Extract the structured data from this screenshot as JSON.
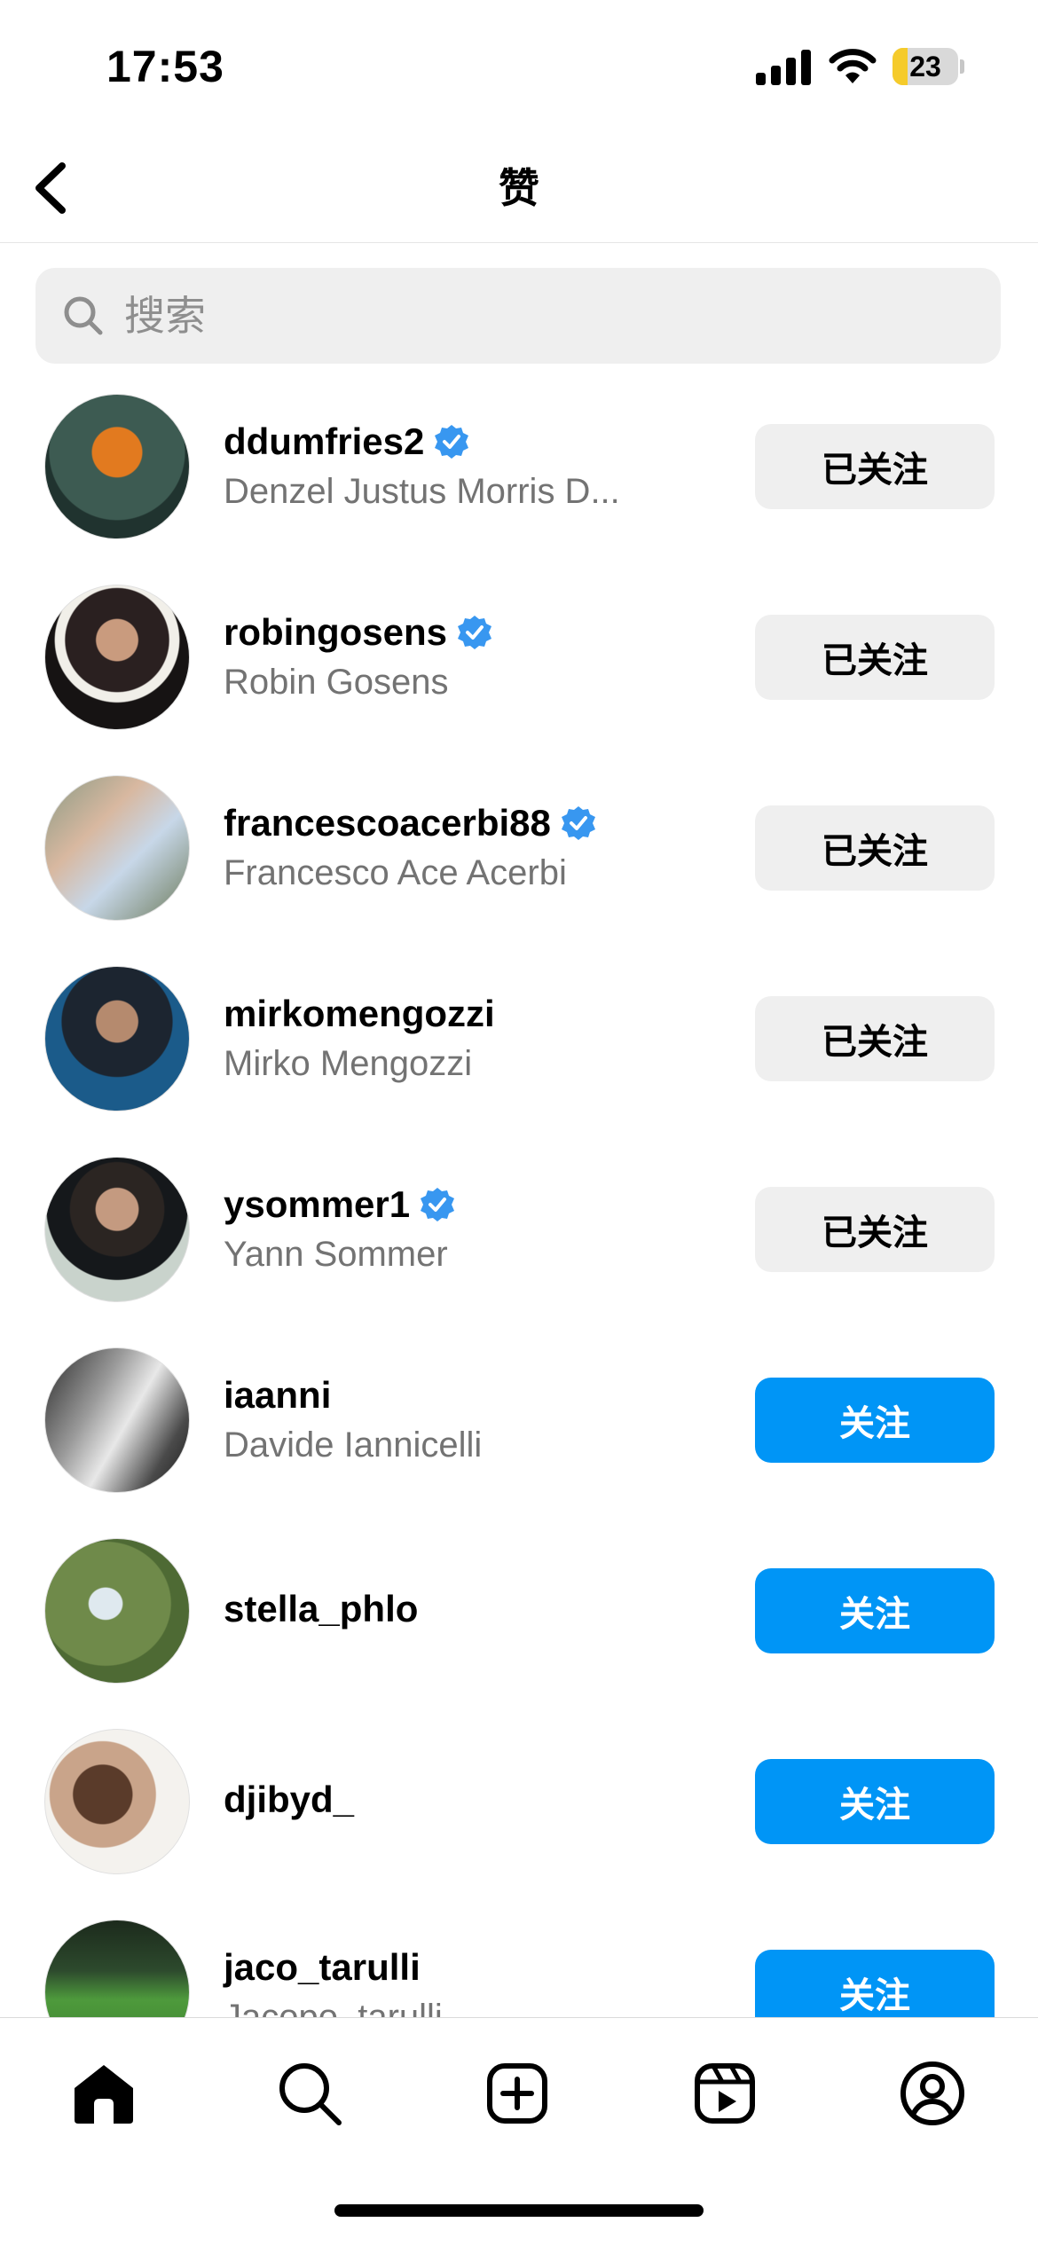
{
  "status_bar": {
    "time": "17:53",
    "battery_level": "23",
    "battery_fraction": 0.23,
    "battery_color": "#f5cb2b"
  },
  "header": {
    "title": "赞",
    "back_icon": "chevron-left-icon"
  },
  "search": {
    "placeholder": "搜索",
    "value": ""
  },
  "colors": {
    "follow_blue": "#0095f6",
    "following_gray": "#efefef",
    "verified_blue": "#3897f0",
    "secondary_text": "#737373"
  },
  "users": [
    {
      "username": "ddumfries2",
      "full_name": "Denzel Justus Morris D...",
      "verified": true,
      "button": "已关注",
      "state": "following"
    },
    {
      "username": "robingosens",
      "full_name": "Robin Gosens",
      "verified": true,
      "button": "已关注",
      "state": "following"
    },
    {
      "username": "francescoacerbi88",
      "full_name": "Francesco Ace Acerbi",
      "verified": true,
      "button": "已关注",
      "state": "following"
    },
    {
      "username": "mirkomengozzi",
      "full_name": "Mirko Mengozzi",
      "verified": false,
      "button": "已关注",
      "state": "following"
    },
    {
      "username": "ysommer1",
      "full_name": "Yann Sommer",
      "verified": true,
      "button": "已关注",
      "state": "following"
    },
    {
      "username": "iaanni",
      "full_name": "Davide Iannicelli",
      "verified": false,
      "button": "关注",
      "state": "follow"
    },
    {
      "username": "stella_phlo",
      "full_name": "",
      "verified": false,
      "button": "关注",
      "state": "follow"
    },
    {
      "username": "djibyd_",
      "full_name": "",
      "verified": false,
      "button": "关注",
      "state": "follow"
    },
    {
      "username": "jaco_tarulli",
      "full_name": "Jacopo_tarulli",
      "verified": false,
      "button": "关注",
      "state": "follow"
    }
  ],
  "tab_bar": {
    "tabs": [
      "home-icon",
      "search-icon",
      "create-post-icon",
      "reels-icon",
      "profile-icon"
    ],
    "active": "home-icon"
  }
}
